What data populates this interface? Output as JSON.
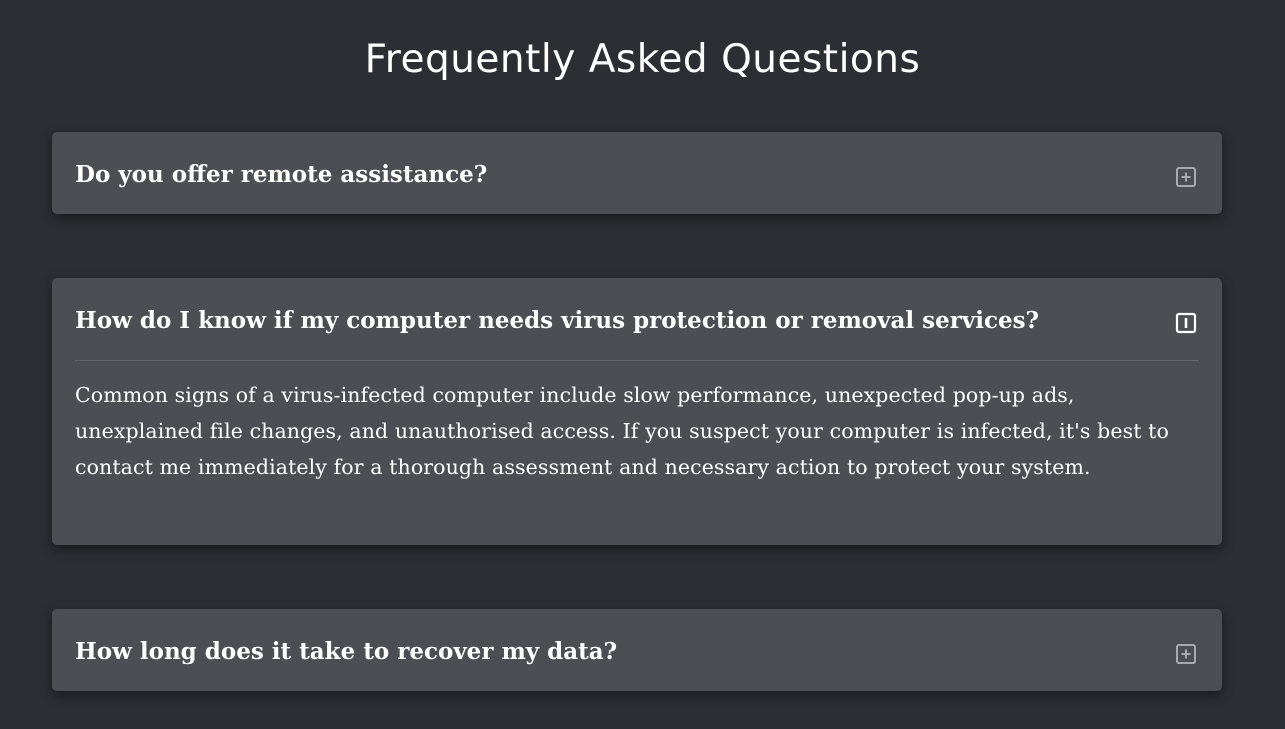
{
  "page": {
    "title": "Frequently Asked Questions"
  },
  "colors": {
    "background": "#2d2e33",
    "card": "#4c4e53",
    "text": "#ffffff",
    "icon_collapsed": "#a9aaad",
    "icon_expanded": "#ffffff"
  },
  "faq": {
    "items": [
      {
        "question": "Do you offer remote assistance?",
        "expanded": false,
        "toggle_icon": "plus-square-icon"
      },
      {
        "question": "How do I know if my computer needs virus protection or removal services?",
        "expanded": true,
        "toggle_icon": "exclamation-square-icon",
        "answer": "Common signs of a virus-infected computer include slow performance, unexpected pop-up ads, unexplained file changes, and unauthorised access. If you suspect your computer is infected, it's best to contact me immediately for a thorough assessment and necessary action to protect your system."
      },
      {
        "question": "How long does it take to recover my data?",
        "expanded": false,
        "toggle_icon": "plus-square-icon"
      }
    ]
  }
}
